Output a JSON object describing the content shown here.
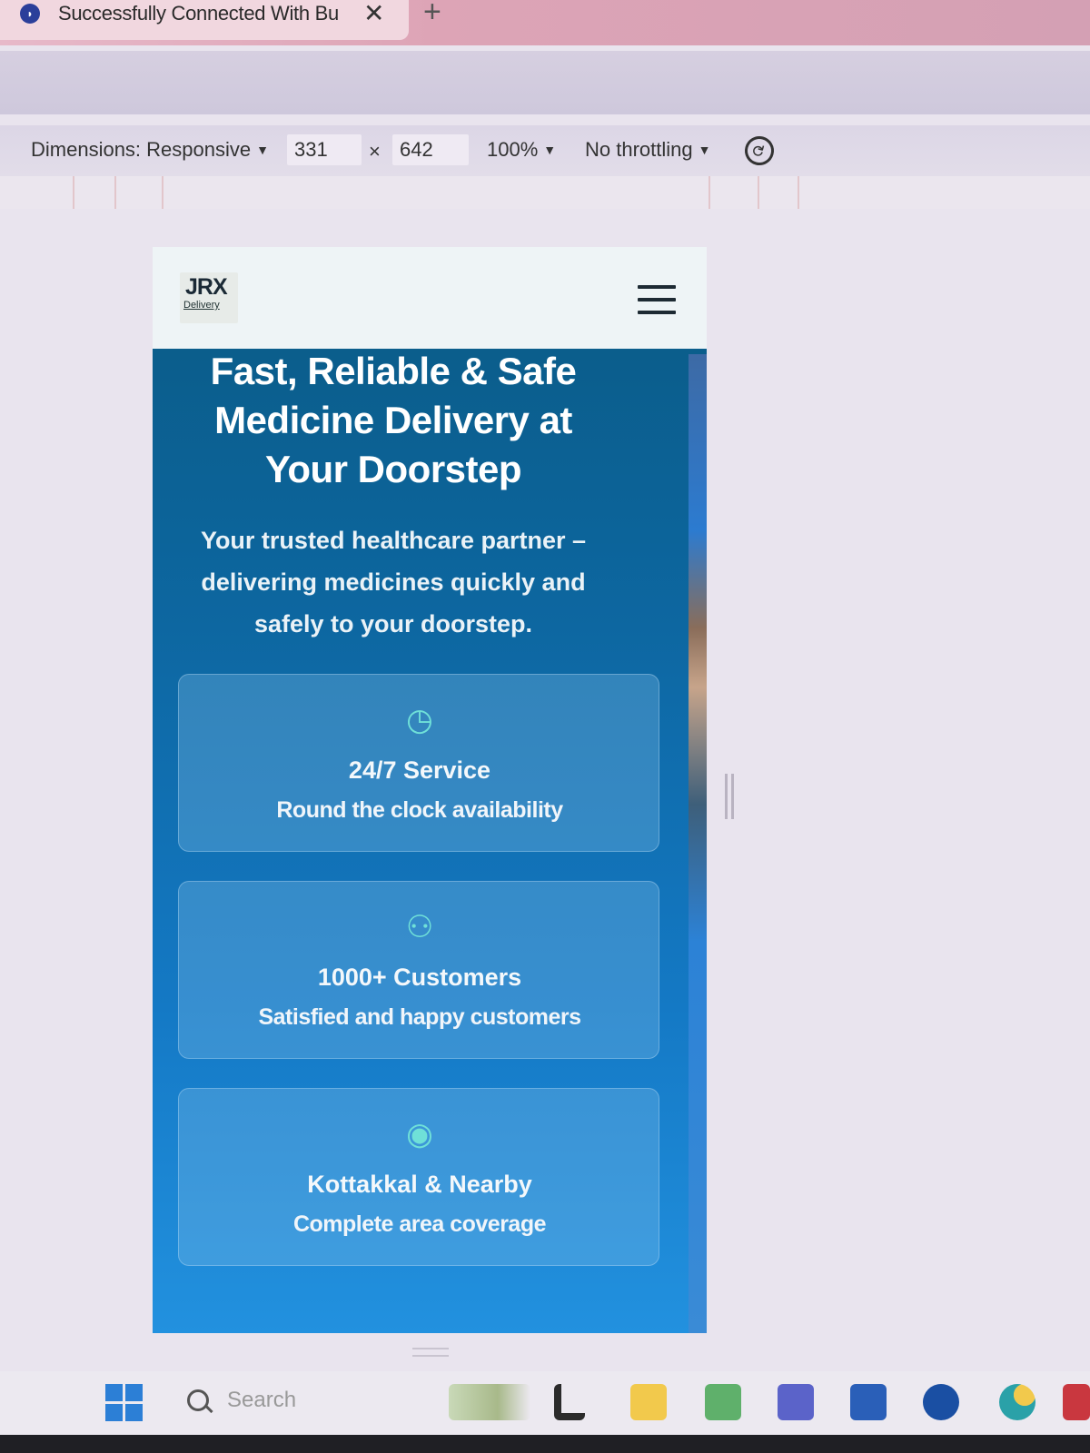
{
  "browser": {
    "tab_title": "Successfully Connected With Bu",
    "tab_close": "✕",
    "new_tab": "+"
  },
  "devtools": {
    "dimensions_label": "Dimensions: Responsive",
    "width": "331",
    "times": "×",
    "height": "642",
    "zoom": "100%",
    "throttling": "No throttling",
    "caret": "▼"
  },
  "site": {
    "logo_mark": "JRX",
    "logo_sub": "Delivery",
    "hero_title": "Fast, Reliable & Safe Medicine Delivery at Your Doorstep",
    "hero_subtitle": "Your trusted healthcare partner – delivering medicines quickly and safely to your doorstep.",
    "stats": [
      {
        "icon": "clock-icon",
        "glyph": "◷",
        "title": "24/7 Service",
        "desc": "Round the clock availability"
      },
      {
        "icon": "users-icon",
        "glyph": "⚇",
        "title": "1000+ Customers",
        "desc": "Satisfied and happy customers"
      },
      {
        "icon": "map-pin-icon",
        "glyph": "◉",
        "title": "Kottakkal & Nearby",
        "desc": "Complete area coverage"
      }
    ]
  },
  "taskbar": {
    "search_placeholder": "Search"
  },
  "colors": {
    "hero_gradient_top": "#0a5a84",
    "hero_gradient_bottom": "#2291df",
    "icon_accent": "#6fe0d8"
  }
}
